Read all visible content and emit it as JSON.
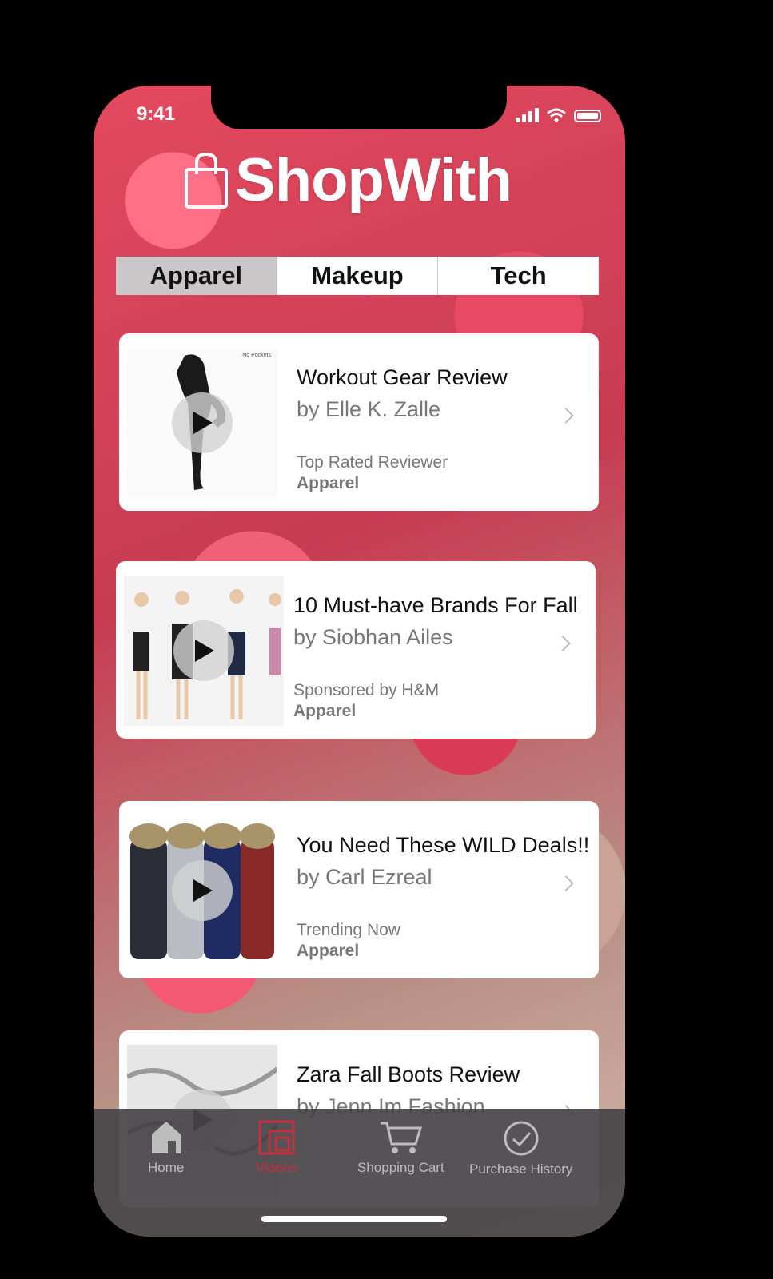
{
  "status": {
    "time": "9:41"
  },
  "app": {
    "name": "ShopWith"
  },
  "segments": [
    {
      "label": "Apparel",
      "active": true
    },
    {
      "label": "Makeup",
      "active": false
    },
    {
      "label": "Tech",
      "active": false
    }
  ],
  "cards": [
    {
      "title": "Workout Gear Review",
      "author": "by Elle K. Zalle",
      "tag": "Top Rated Reviewer",
      "category": "Apparel",
      "thumb_note": "No Pockets"
    },
    {
      "title": "10 Must-have Brands For Fall",
      "author": "by Siobhan Ailes",
      "tag": "Sponsored by H&M",
      "category": "Apparel"
    },
    {
      "title": "You Need These WILD Deals!!",
      "author": "by Carl Ezreal",
      "tag": "Trending Now",
      "category": "Apparel"
    },
    {
      "title": "Zara Fall Boots Review",
      "author": "by Jenn Im Fashion",
      "tag": "",
      "category": ""
    }
  ],
  "tabbar": [
    {
      "label": "Home",
      "icon": "home-icon",
      "active": false
    },
    {
      "label": "Videos",
      "icon": "videos-icon",
      "active": true
    },
    {
      "label": "Shopping Cart",
      "icon": "cart-icon",
      "active": false
    },
    {
      "label": "Purchase History",
      "icon": "clock-icon",
      "active": false
    }
  ],
  "colors": {
    "accent": "#c4303f",
    "tabbar": "#464446"
  }
}
